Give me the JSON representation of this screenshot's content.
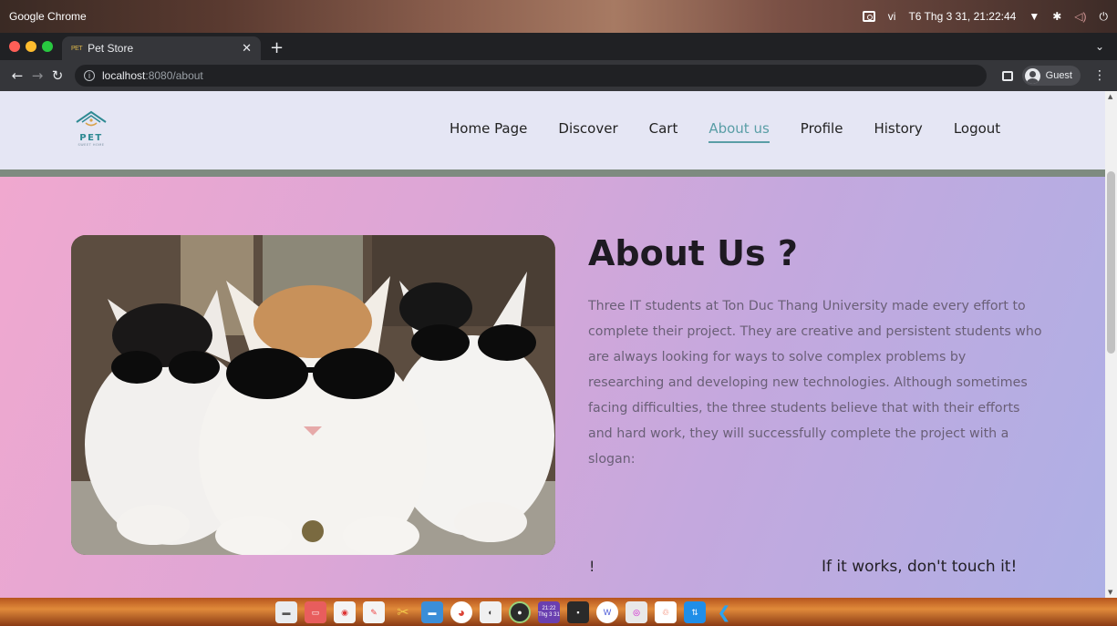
{
  "os": {
    "app_name": "Google Chrome",
    "tray_lang": "vi",
    "clock": "T6 Thg 3 31, 21:22:44"
  },
  "browser": {
    "tab_title": "Pet Store",
    "tab_favicon_text": "PET",
    "url_host": "localhost",
    "url_path": ":8080/about",
    "profile": "Guest"
  },
  "site": {
    "logo_text": "PET",
    "logo_subtext": "SWEET HOME",
    "nav": [
      "Home Page",
      "Discover",
      "Cart",
      "About us",
      "Profile",
      "History",
      "Logout"
    ],
    "active_nav": "About us"
  },
  "about": {
    "title": "About Us ?",
    "body": "Three IT students at Ton Duc Thang University made every effort to complete their project. They are creative and persistent students who are always looking for ways to solve complex problems by researching and developing new technologies. Although sometimes facing difficulties, the three students believe that with their efforts and hard work, they will successfully complete the project with a slogan:",
    "bang": "!",
    "slogan": "If it works, don't touch it!"
  },
  "dock": {
    "clock_time": "21:22",
    "clock_date": "Thg 3 31"
  },
  "colors": {
    "accent_teal": "#5a9ea6",
    "hero_start": "#f0a8cf",
    "hero_end": "#aeb0e5"
  }
}
